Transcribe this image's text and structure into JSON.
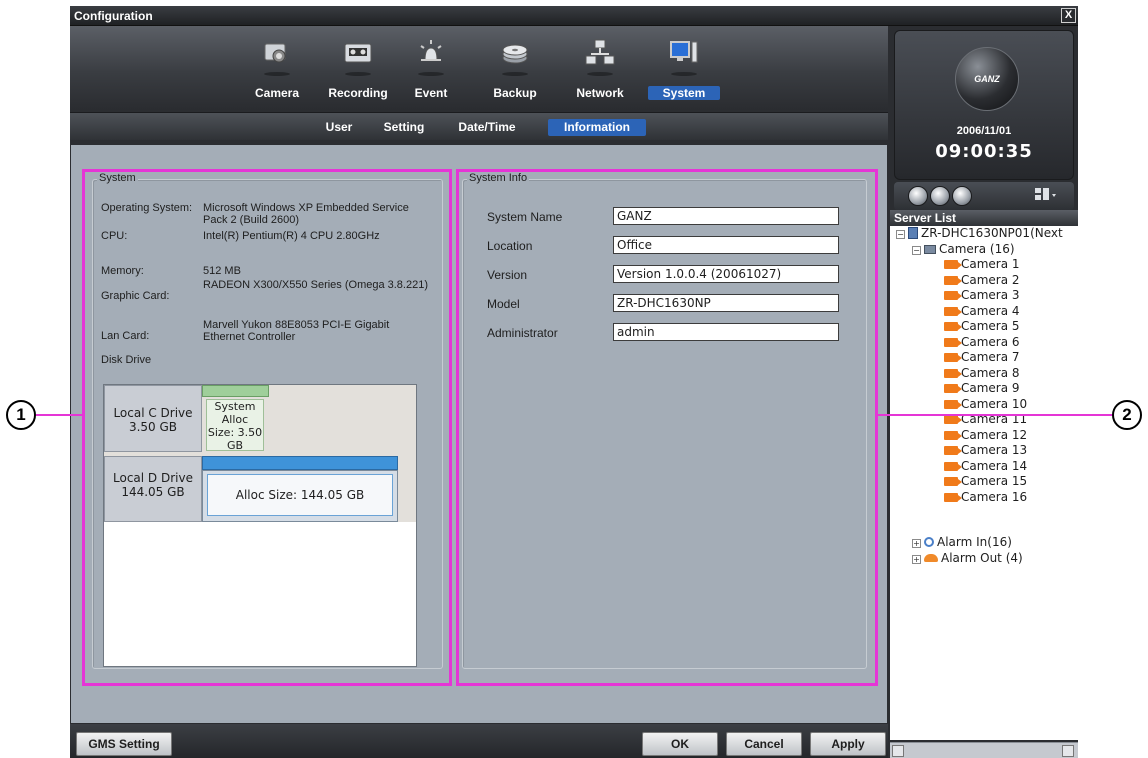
{
  "window": {
    "title": "Configuration",
    "close_glyph": "X"
  },
  "nav": {
    "items": [
      {
        "label": "Camera",
        "icon": "camera-icon"
      },
      {
        "label": "Recording",
        "icon": "tape-icon"
      },
      {
        "label": "Event",
        "icon": "alarm-icon"
      },
      {
        "label": "Backup",
        "icon": "disc-icon"
      },
      {
        "label": "Network",
        "icon": "network-icon"
      },
      {
        "label": "System",
        "icon": "monitor-icon",
        "active": true
      }
    ],
    "sub_items": [
      {
        "label": "User"
      },
      {
        "label": "Setting"
      },
      {
        "label": "Date/Time"
      },
      {
        "label": "Information",
        "active": true
      }
    ]
  },
  "system_panel": {
    "legend": "System",
    "rows": [
      {
        "label": "Operating System:",
        "value": "Microsoft Windows XP Embedded Service Pack 2 (Build 2600)"
      },
      {
        "label": "CPU:",
        "value": "Intel(R) Pentium(R) 4 CPU 2.80GHz"
      },
      {
        "label": "Memory:",
        "value": "512 MB"
      },
      {
        "label": "Graphic Card:",
        "value": "RADEON X300/X550 Series (Omega 3.8.221)"
      },
      {
        "label": "Lan Card:",
        "value": "Marvell Yukon 88E8053 PCI-E Gigabit Ethernet Controller"
      },
      {
        "label": "Disk Drive",
        "value": ""
      }
    ],
    "drives": [
      {
        "name": "Local C Drive",
        "size": "3.50 GB",
        "partition": "System Alloc Size: 3.50 GB"
      },
      {
        "name": "Local D Drive",
        "size": "144.05 GB",
        "partition": "Alloc Size: 144.05 GB"
      }
    ]
  },
  "info_panel": {
    "legend": "System Info",
    "fields": [
      {
        "label": "System Name",
        "value": "GANZ"
      },
      {
        "label": "Location",
        "value": "Office"
      },
      {
        "label": "Version",
        "value": "Version 1.0.0.4 (20061027)"
      },
      {
        "label": "Model",
        "value": "ZR-DHC1630NP"
      },
      {
        "label": "Administrator",
        "value": "admin"
      }
    ]
  },
  "buttons": {
    "gms": "GMS Setting",
    "ok": "OK",
    "cancel": "Cancel",
    "apply": "Apply"
  },
  "clock": {
    "brand": "GANZ",
    "date": "2006/11/01",
    "time": "09:00:35"
  },
  "server_list": {
    "title": "Server List",
    "server": "ZR-DHC1630NP01(Next",
    "camera_group": "Camera (16)",
    "cameras": [
      "Camera 1",
      "Camera 2",
      "Camera 3",
      "Camera 4",
      "Camera 5",
      "Camera 6",
      "Camera 7",
      "Camera 8",
      "Camera 9",
      "Camera 10",
      "Camera 11",
      "Camera 12",
      "Camera 13",
      "Camera 14",
      "Camera 15",
      "Camera 16"
    ],
    "alarm_in": "Alarm In(16)",
    "alarm_out": "Alarm Out (4)"
  },
  "callouts": [
    "1",
    "2"
  ],
  "colors": {
    "highlight": "#e535d6",
    "active_tab": "#2c64b7",
    "panel_bg": "#a4adb7"
  }
}
